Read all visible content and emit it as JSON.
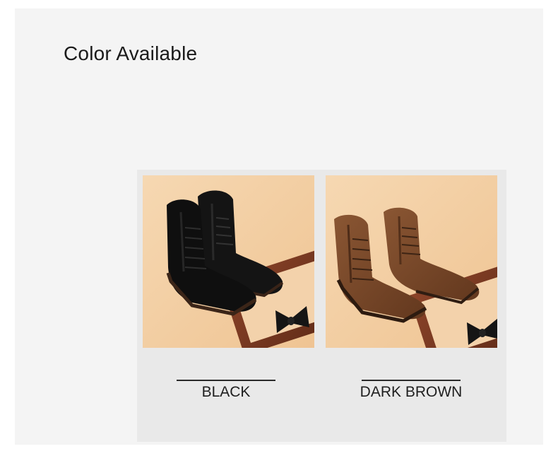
{
  "section": {
    "heading": "Color Available"
  },
  "colors": [
    {
      "label": "BLACK",
      "boot_color": "#121212",
      "icon": "black-suede-boots-photo"
    },
    {
      "label": "DARK BROWN",
      "boot_color": "#7a4a2a",
      "icon": "dark-brown-suede-boots-photo"
    }
  ],
  "theme": {
    "background": "#f4f4f4",
    "photo_backdrop": "#f2cfa6",
    "frame_wood": "#7a3a22"
  }
}
